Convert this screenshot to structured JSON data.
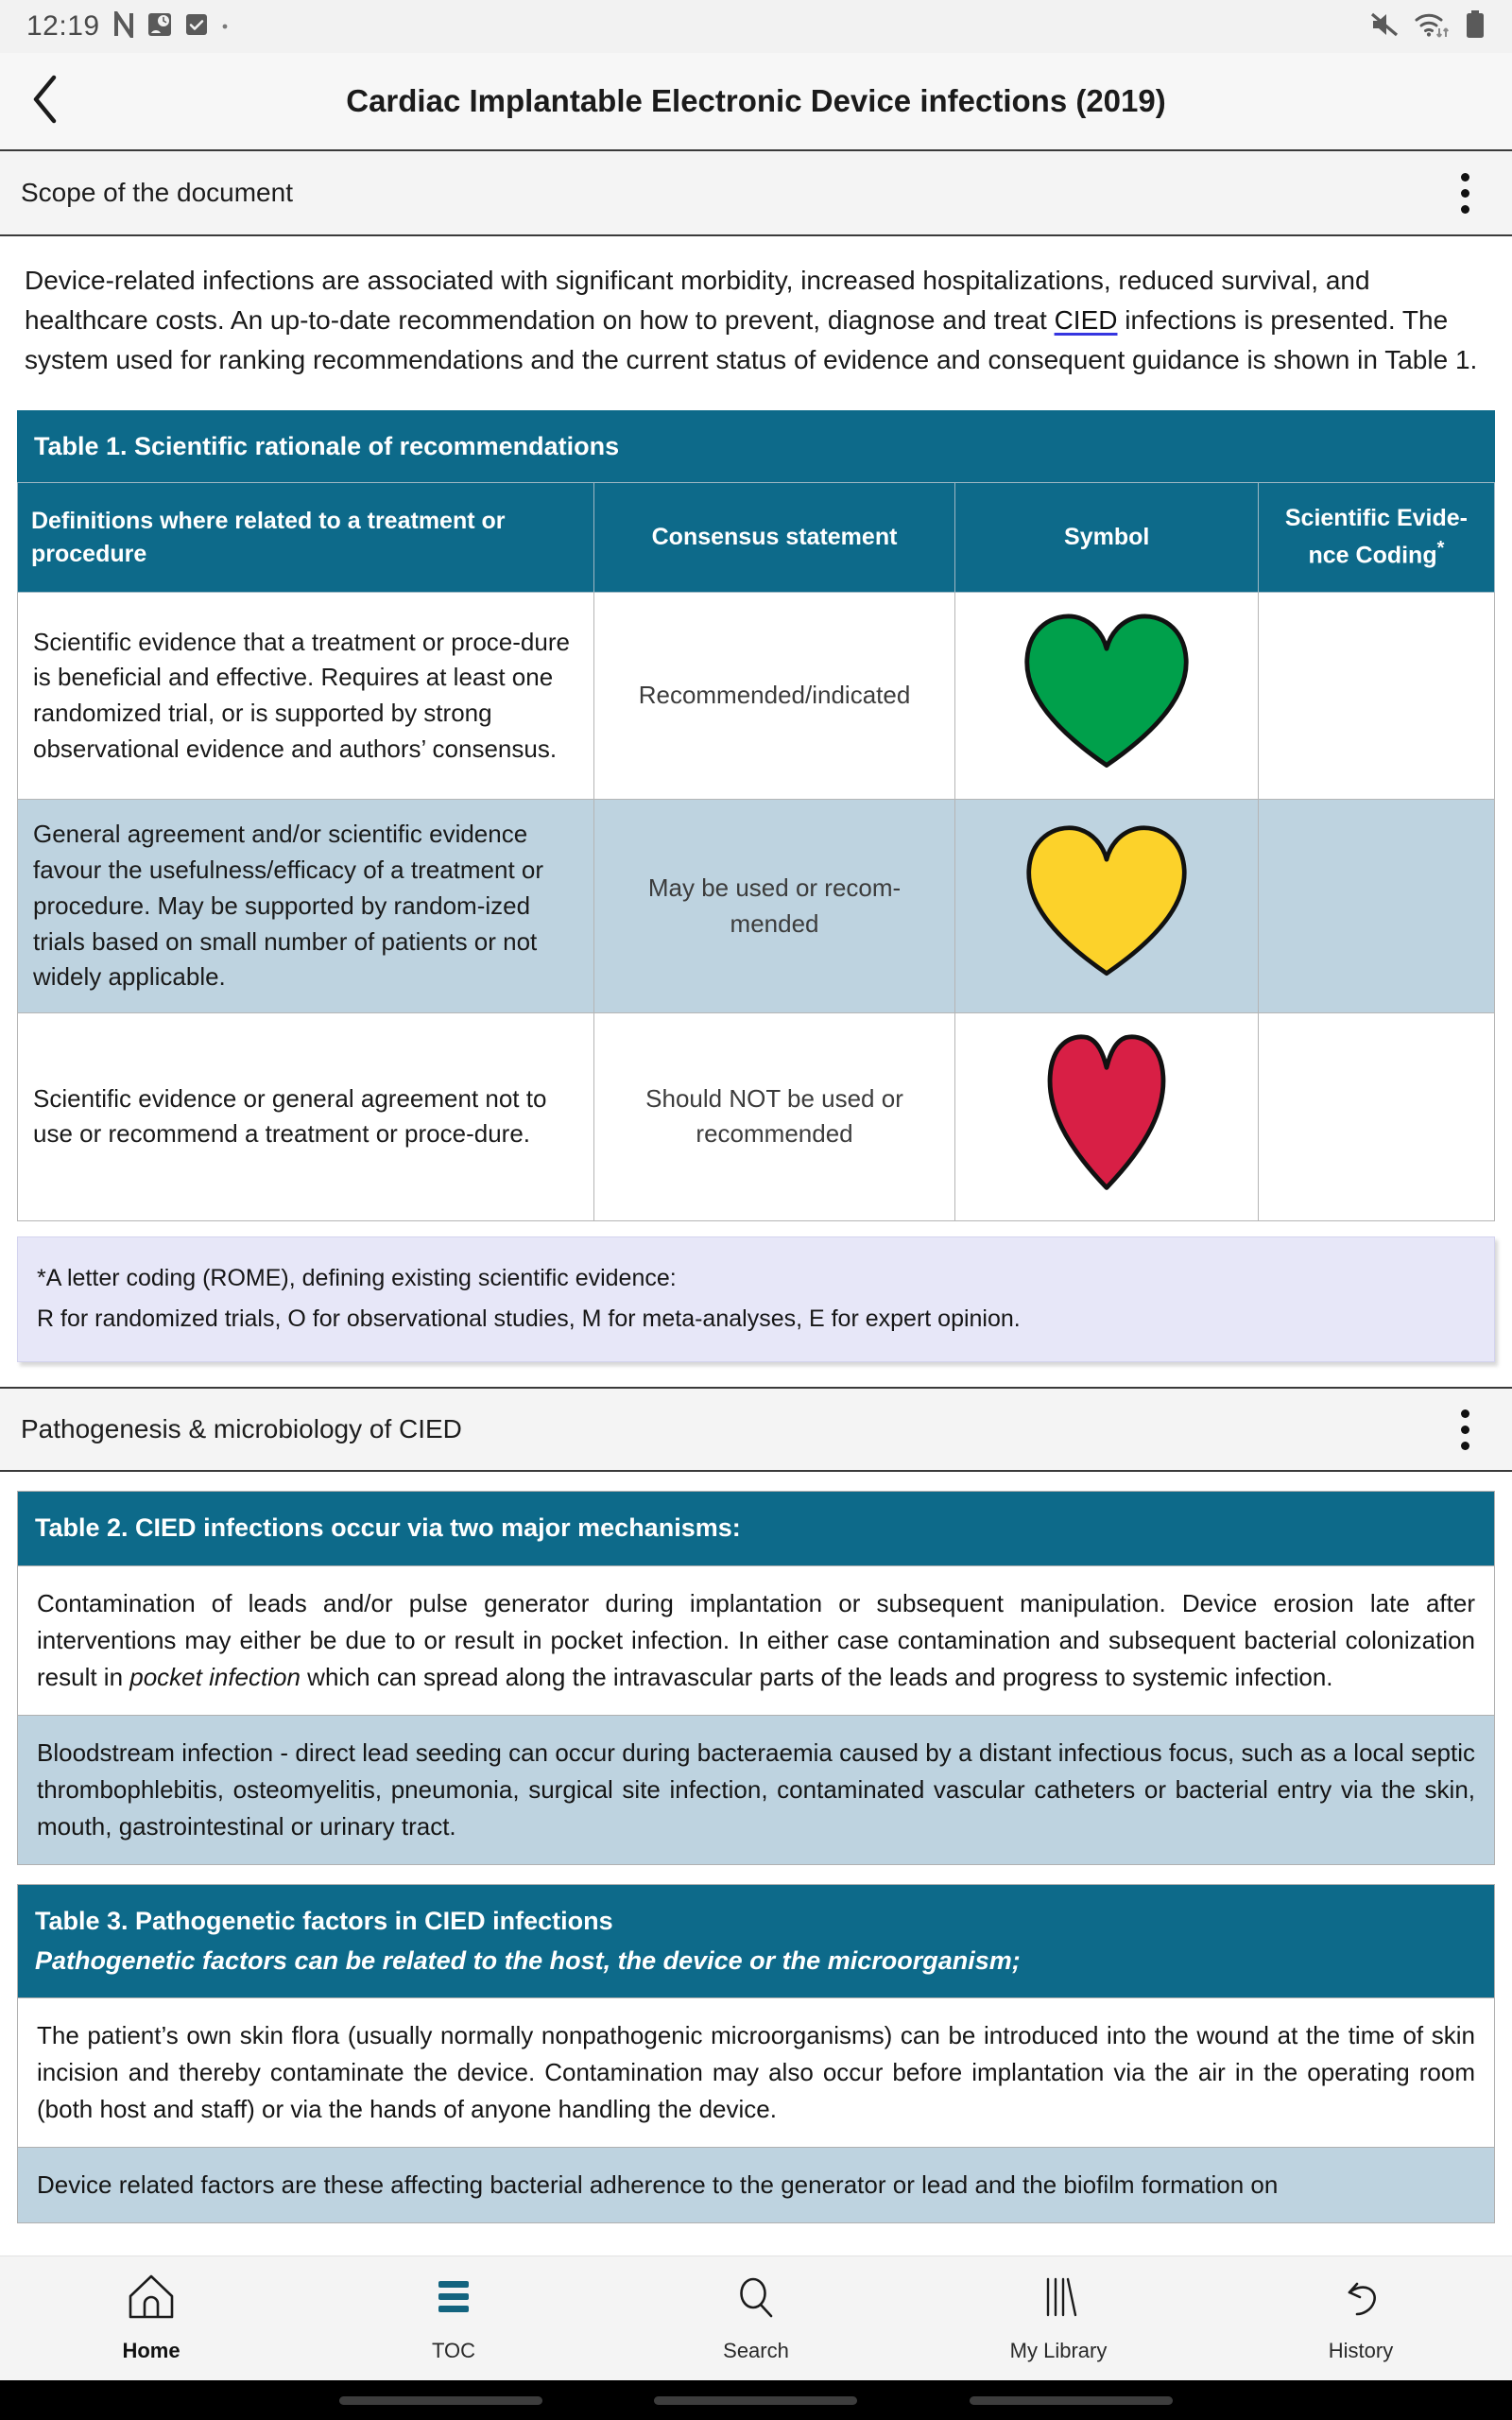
{
  "status_bar": {
    "time": "12:19",
    "left_icons": [
      "nfc-n-icon",
      "alarm-icon",
      "checkbox-icon",
      "dot-icon"
    ],
    "right_icons": [
      "mute-icon",
      "wifi-data-icon",
      "battery-icon"
    ]
  },
  "app_bar": {
    "back_icon": "chevron-left-icon",
    "title": "Cardiac Implantable Electronic Device infections (2019)"
  },
  "sections": {
    "scope": {
      "title": "Scope of the document",
      "menu_icon": "kebab-menu-icon"
    },
    "pathogenesis": {
      "title": "Pathogenesis & microbiology of CIED",
      "menu_icon": "kebab-menu-icon"
    }
  },
  "intro": {
    "part1": "Device-related infections are associated with significant morbidity, increased hospitalizations, reduced survival, and healthcare costs. An up-to-date recommendation on how to prevent, diagnose and treat ",
    "link": "CIED",
    "part2": " infections is presented. The system used for ranking recommendations and the current status of evidence and consequent guidance is shown in Table 1."
  },
  "table1": {
    "caption": "Table 1. Scientific rationale of recommendations",
    "headers": [
      "Definitions where related to a treatment or procedure",
      "Consensus statement",
      "Symbol",
      "Scientific Evide-nce Coding"
    ],
    "header_star": "*",
    "rows": [
      {
        "definition": "Scientific evidence that a treatment or proce-dure is beneficial and effective. Requires at least one randomized trial, or is supported by strong observational evidence and authors’ consensus.",
        "consensus": "Recommended/indicated",
        "symbol": "green-heart-icon",
        "symbol_color": "#00A04B",
        "coding": "",
        "shaded": false
      },
      {
        "definition": "General agreement and/or scientific evidence favour the usefulness/efficacy of a treatment or procedure. May be supported by random-ized trials based on small number of patients or not widely applicable.",
        "consensus": "May be used or recom-mended",
        "symbol": "yellow-heart-icon",
        "symbol_color": "#FCD22A",
        "coding": "",
        "shaded": true
      },
      {
        "definition": "Scientific evidence or general agreement not to use or recommend a treatment or proce-dure.",
        "consensus": "Should NOT be used or recommended",
        "symbol": "red-heart-icon",
        "symbol_color": "#D81F45",
        "coding": "",
        "shaded": false
      }
    ]
  },
  "footnote": {
    "line1": "*A letter coding (ROME), defining existing scientific evidence:",
    "line2": "R for randomized trials, O for observational studies, M for meta-analyses, E for expert opinion."
  },
  "table2": {
    "caption_prefix": "Table 2. ",
    "caption_link": "CIED",
    "caption_suffix": " infections occur via two major mechanisms:",
    "rows": [
      {
        "text_a": "Contamination of leads and/or pulse generator during implantation or subsequent manipulation. Device erosion late after interventions may either be due to or result in pocket infection. In either case contamination and subsequent bacterial colonization result in ",
        "italic": "pocket infection",
        "text_b": " which can spread along the intravascular parts of the leads and progress to systemic infection.",
        "shaded": false
      },
      {
        "text_a": "Bloodstream infection - direct lead seeding can occur during bacteraemia caused by a distant infectious focus, such as a local septic thrombophlebitis, osteomyelitis, pneumonia, surgical site infection, contaminated vascular catheters or bacterial entry via the skin, mouth, gastrointestinal or urinary tract.",
        "italic": "",
        "text_b": "",
        "shaded": true
      }
    ]
  },
  "table3": {
    "caption_prefix": "Table 3. Pathogenetic factors in ",
    "caption_link": "CIED",
    "caption_suffix": " infections",
    "caption_sub": "Pathogenetic factors can be related to the host, the device or the microorganism;",
    "rows": [
      {
        "text_a": "The patient’s own skin flora (usually normally nonpathogenic microorganisms) can be introduced into the wound at the time of skin incision and thereby contaminate the device. Contamination may also occur before implantation via the air in the operating room (both host and staff) or via the hands of anyone handling the device.",
        "shaded": false
      },
      {
        "text_a": "Device related factors are these affecting bacterial adherence to the generator or lead and the biofilm formation on",
        "shaded": true
      }
    ]
  },
  "bottom_nav": {
    "items": [
      {
        "label": "Home",
        "icon": "home-icon",
        "active": true
      },
      {
        "label": "TOC",
        "icon": "list-icon",
        "active": false
      },
      {
        "label": "Search",
        "icon": "search-icon",
        "active": false
      },
      {
        "label": "My Library",
        "icon": "books-icon",
        "active": false
      },
      {
        "label": "History",
        "icon": "undo-arrow-icon",
        "active": false
      }
    ]
  },
  "colors": {
    "table_header_teal": "#0d6a8a",
    "row_shade_blue": "#bed3e0",
    "footnote_lavender": "#e7e7f8",
    "link_underline": "#3535e0",
    "accent_teal": "#13647f"
  }
}
